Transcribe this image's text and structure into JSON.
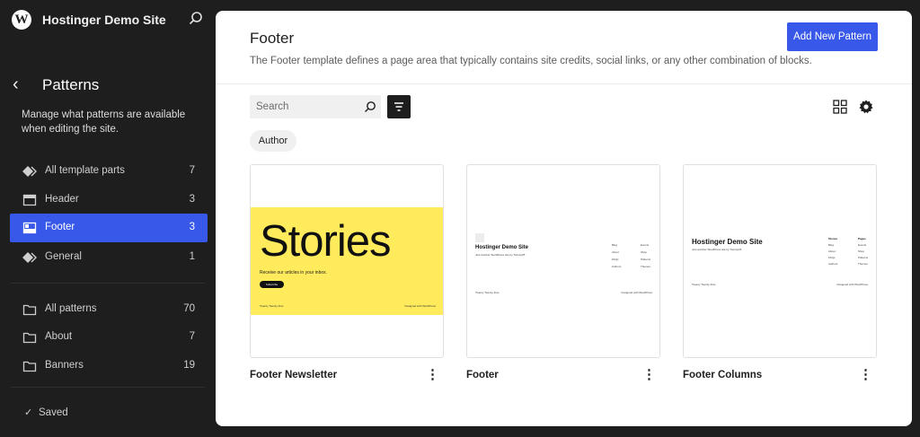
{
  "site": {
    "title": "Hostinger Demo Site"
  },
  "sidebar": {
    "title": "Patterns",
    "description": "Manage what patterns are available when editing the site.",
    "template_parts": [
      {
        "label": "All template parts",
        "count": "7",
        "icon": "diamond-icon"
      },
      {
        "label": "Header",
        "count": "3",
        "icon": "header-icon"
      },
      {
        "label": "Footer",
        "count": "3",
        "icon": "footer-icon",
        "active": true
      },
      {
        "label": "General",
        "count": "1",
        "icon": "diamond-icon"
      }
    ],
    "categories": [
      {
        "label": "All patterns",
        "count": "70",
        "icon": "folder-icon"
      },
      {
        "label": "About",
        "count": "7",
        "icon": "folder-icon"
      },
      {
        "label": "Banners",
        "count": "19",
        "icon": "folder-icon"
      }
    ],
    "status": "Saved"
  },
  "main": {
    "title": "Footer",
    "description": "The Footer template defines a page area that typically contains site credits, social links, or any other combination of blocks.",
    "add_button": "Add New Pattern",
    "search_placeholder": "Search",
    "filter_chip": "Author",
    "accent_color": "#3858e9",
    "cards": [
      {
        "title": "Footer Newsletter",
        "preview": {
          "heading": "Stories",
          "text": "Receive our articles in your inbox.",
          "button": "Subscribe",
          "footer_left": "Twenty Twenty-Five",
          "footer_right": "Designed with WordPress",
          "background": "#ffeb5b"
        }
      },
      {
        "title": "Footer",
        "preview": {
          "site": "Hostinger Demo Site",
          "tagline": "Just another WordPress site by Twenty25",
          "col1": [
            "Blog",
            "About",
            "FAQs",
            "Authors"
          ],
          "col2": [
            "Events",
            "Shop",
            "Patterns",
            "Themes"
          ],
          "footer_left": "Twenty Twenty-Five",
          "footer_right": "Designed with WordPress"
        }
      },
      {
        "title": "Footer Columns",
        "preview": {
          "site": "Hostinger Demo Site",
          "tagline": "Just another WordPress site by Twenty25",
          "col1_head": "Stories",
          "col1": [
            "Blog",
            "About",
            "FAQs",
            "Authors"
          ],
          "col2_head": "Pages",
          "col2": [
            "Events",
            "Shop",
            "Patterns",
            "Themes"
          ],
          "footer_left": "Twenty Twenty-Five",
          "footer_right": "Designed with WordPress"
        }
      }
    ]
  }
}
